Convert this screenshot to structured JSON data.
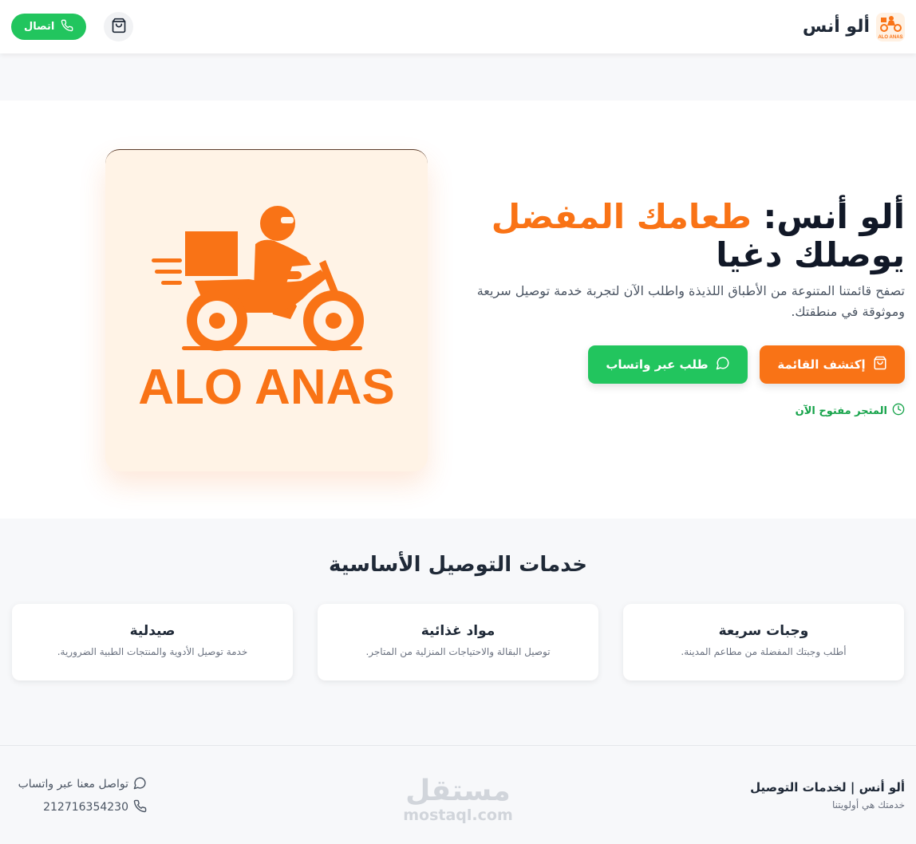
{
  "header": {
    "brand_name": "ألو أنس",
    "logo_text": "ALO ANAS",
    "call_label": "اتصال"
  },
  "hero": {
    "title_part1": "ألو أنس: ",
    "title_accent": "طعامك المفضل",
    "title_part2": "يوصلك دغيا",
    "description": "تصفح قائمتنا المتنوعة من الأطباق اللذيذة واطلب الآن لتجربة خدمة توصيل سريعة وموثوقة في منطقتك.",
    "explore_label": "إكتشف القائمة",
    "whatsapp_order_label": "طلب عبر واتساب",
    "store_status": "المتجر مفتوح الآن",
    "image_text": "ALO ANAS"
  },
  "services": {
    "title": "خدمات التوصيل الأساسية",
    "items": [
      {
        "title": "وجبات سريعة",
        "description": "أطلب وجبتك المفضلة من مطاعم المدينة."
      },
      {
        "title": "مواد غذائية",
        "description": "توصيل البقالة والاحتياجات المنزلية من المتاجر."
      },
      {
        "title": "صيدلية",
        "description": "خدمة توصيل الأدوية والمنتجات الطبية الضرورية."
      }
    ]
  },
  "footer": {
    "brand": "ألو أنس | لخدمات التوصيل",
    "tagline": "خدمتك هي أولويتنا",
    "whatsapp_contact": "تواصل معنا عبر واتساب",
    "phone": "212716354230"
  },
  "watermark": {
    "arabic": "مستقل",
    "latin": "mostaql.com"
  },
  "colors": {
    "accent": "#f97316",
    "green": "#22c55e"
  }
}
